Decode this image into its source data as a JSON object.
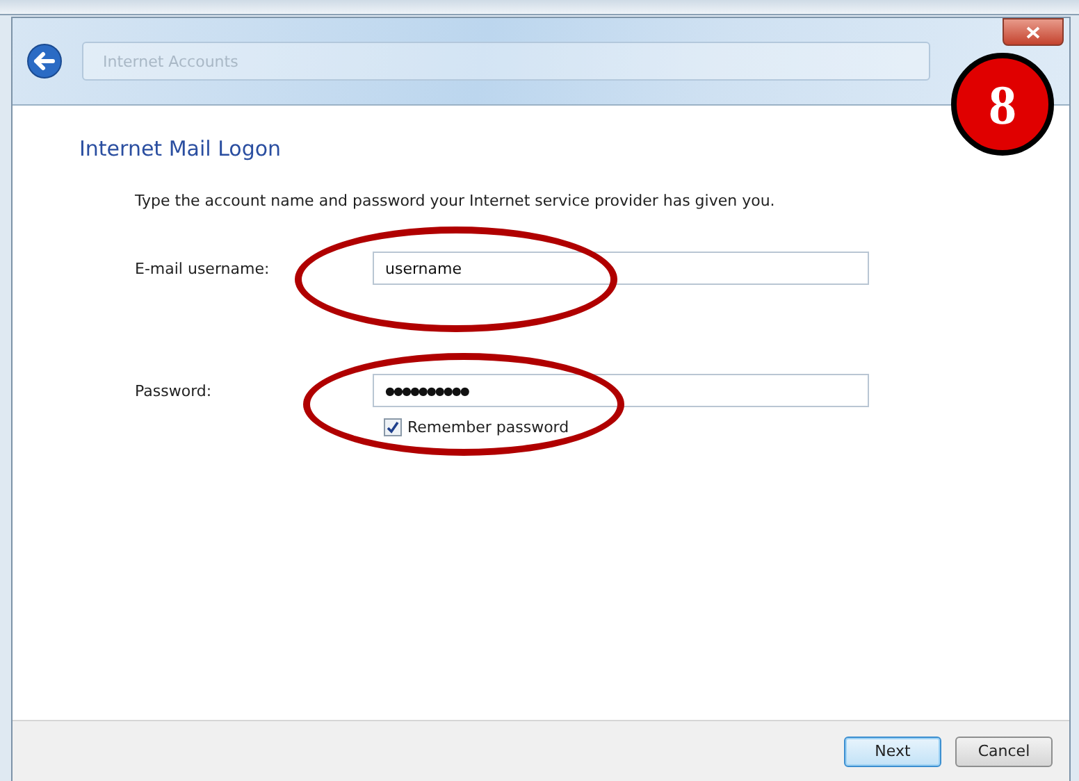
{
  "window": {
    "title": "Internet Accounts"
  },
  "badge": "8",
  "heading": "Internet Mail Logon",
  "instruction": "Type the account name and password your Internet service provider has given you.",
  "fields": [
    {
      "label": "E-mail username:",
      "value": "username",
      "highlighted": true
    },
    {
      "label": "Password:",
      "value": "●●●●●●●●●●",
      "highlighted": true
    }
  ],
  "remember": {
    "label": "Remember password",
    "checked": true
  },
  "buttons": [
    {
      "label": "Next",
      "selected": true
    },
    {
      "label": "Cancel",
      "selected": false
    }
  ]
}
